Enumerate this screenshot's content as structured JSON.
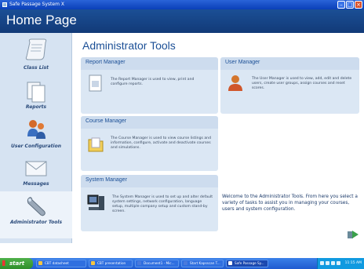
{
  "window": {
    "title": "Safe Passage System X"
  },
  "header": {
    "title": "Home Page"
  },
  "sidebar": {
    "items": [
      {
        "label": "Class List",
        "icon": "scroll-icon"
      },
      {
        "label": "Reports",
        "icon": "documents-icon"
      },
      {
        "label": "User Configuration",
        "icon": "users-key-icon"
      },
      {
        "label": "Messages",
        "icon": "envelope-icon"
      },
      {
        "label": "Administrator Tools",
        "icon": "wrench-icon"
      }
    ]
  },
  "main": {
    "title": "Administrator Tools",
    "panels": {
      "report_manager": {
        "title": "Report Manager",
        "desc": "The Report Manager is used to view, print and configure reports."
      },
      "user_manager": {
        "title": "User Manager",
        "desc": "The User Manager is used to view, add, edit and delete users, create user groups, assign courses and reset scores."
      },
      "course_manager": {
        "title": "Course Manager",
        "desc": "The Course Manager is used to view course listings and information, configure, activate and deactivate courses and simulations."
      },
      "system_manager": {
        "title": "System Manager",
        "desc": "The System Manager is used to set up and alter default system settings, network configuration, language setup, multiple company setup and custom stand-by screen."
      }
    },
    "welcome": "Welcome to the Administrator Tools. From here you select a variety of tasks to assist you in managing your courses, users and system configuration."
  },
  "taskbar": {
    "start": "start",
    "items": [
      "CBT datasheet",
      "CBT presentation",
      "Document1 - Mic...",
      "Start Kapsscan T...",
      "Safe Passage Sy..."
    ],
    "clock": "11:15 AM"
  },
  "colors": {
    "accent": "#1b4f96",
    "panel": "#dbe7f4",
    "sidebar": "#d6e3f2"
  }
}
